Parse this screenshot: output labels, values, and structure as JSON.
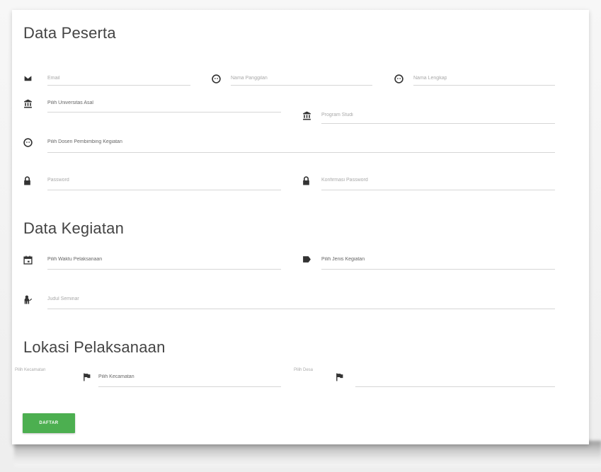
{
  "colors": {
    "accent": "#4caf50",
    "text": "#444444",
    "underline": "#d6d6d6"
  },
  "sections": {
    "participant_title": "Data Peserta",
    "activity_title": "Data Kegiatan",
    "location_title": "Lokasi Pelaksanaan"
  },
  "participant": {
    "email": {
      "icon": "envelope-icon",
      "placeholder": "Email"
    },
    "nickname": {
      "icon": "face-icon",
      "placeholder": "Nama Panggilan"
    },
    "fullname": {
      "icon": "face-icon",
      "placeholder": "Nama Lengkap"
    },
    "university": {
      "icon": "bank-icon",
      "value": "Pilih Universitas Asal"
    },
    "study_program": {
      "icon": "bank-icon",
      "placeholder": "Program Studi"
    },
    "advisor": {
      "icon": "face-icon",
      "value": "Pilih Dosen Pembimbing Kegiatan"
    },
    "password": {
      "icon": "lock-icon",
      "placeholder": "Password"
    },
    "password_confirm": {
      "icon": "lock-icon",
      "placeholder": "Konfirmasi Password"
    }
  },
  "activity": {
    "time": {
      "icon": "calendar-icon",
      "value": "Pilih Waktu Pelaksanaan"
    },
    "type": {
      "icon": "label-icon",
      "value": "Pilih Jenis Kegiatan"
    },
    "seminar_title": {
      "icon": "person-icon",
      "placeholder": "Judul Seminar"
    }
  },
  "location": {
    "district_label": "Pilih Kecamatan",
    "district": {
      "icon": "flag-icon",
      "value": "Pilih Kecamatan"
    },
    "village_label": "Pilih Desa",
    "village": {
      "icon": "flag-icon",
      "value": ""
    }
  },
  "submit_label": "DAFTAR"
}
